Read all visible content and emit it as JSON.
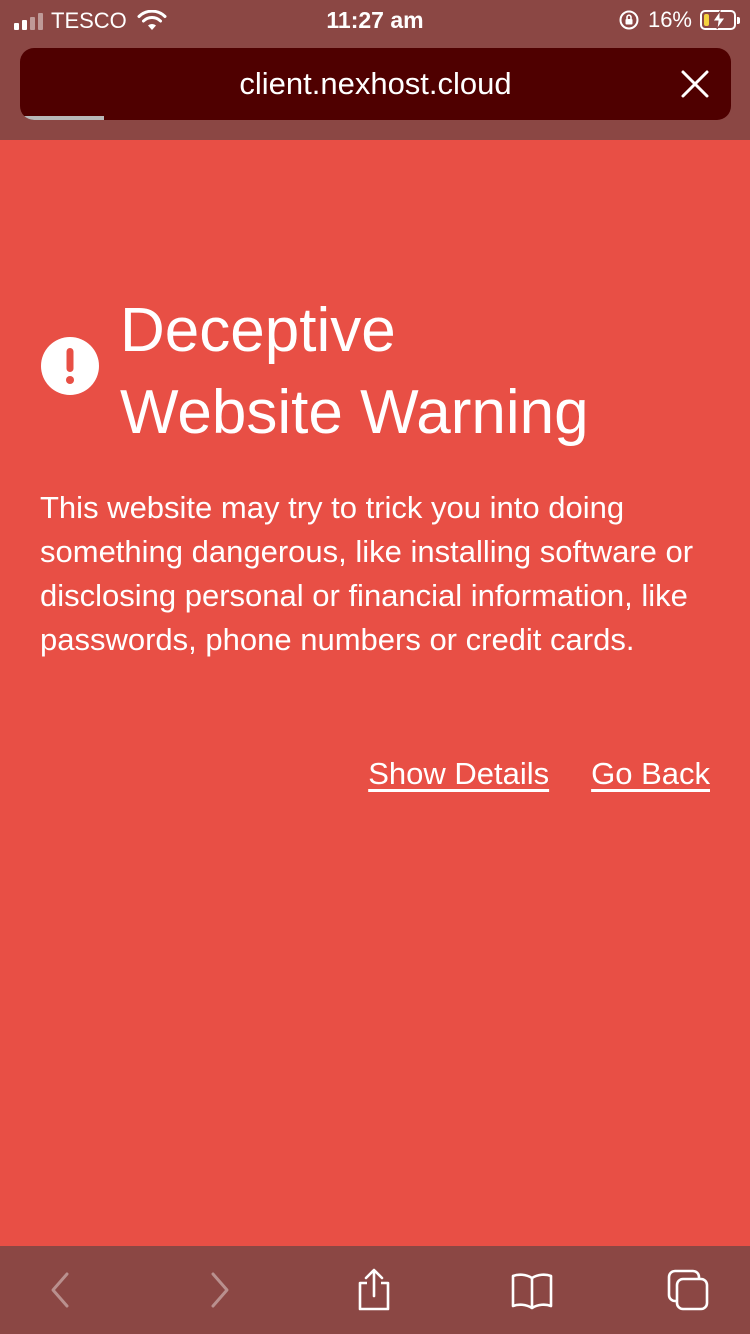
{
  "status_bar": {
    "carrier": "TESCO",
    "time": "11:27 am",
    "battery_percent": "16%",
    "battery_level": 0.16,
    "battery_color": "#f5d23c"
  },
  "browser": {
    "url": "client.nexhost.cloud",
    "close_icon": "close-icon"
  },
  "warning": {
    "icon": "exclamation-circle-icon",
    "title_line1": "Deceptive",
    "title_line2": "Website Warning",
    "body": "This website may try to trick you into doing something dangerous, like installing software or disclosing personal or financial information, like passwords, phone numbers or credit cards.",
    "show_details": "Show Details",
    "go_back": "Go Back",
    "background_color": "#e84f45"
  },
  "toolbar": {
    "icons": [
      "back-icon",
      "forward-icon",
      "share-icon",
      "bookmarks-icon",
      "tabs-icon"
    ],
    "background_color": "#8b4744"
  }
}
